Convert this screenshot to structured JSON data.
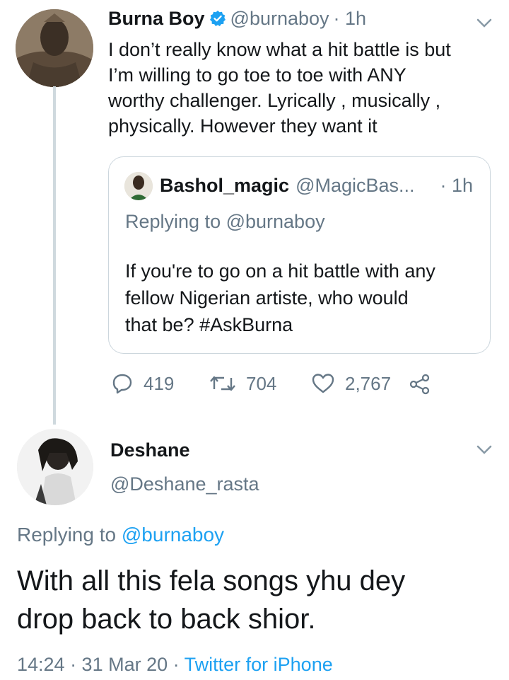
{
  "tweet": {
    "author_name": "Burna Boy",
    "handle": "@burnaboy",
    "time": "· 1h",
    "text": "I don’t really know what a hit battle is but\nI’m willing to go toe to toe with ANY\nworthy challenger. Lyrically , musically ,\nphysically. However they want it",
    "quote": {
      "author_name": "Bashol_magic",
      "handle": "@MagicBas...",
      "time": "· 1h",
      "replying_prefix": "Replying to ",
      "replying_handle": "@burnaboy",
      "text": "If you're to go on a hit battle with any\nfellow Nigerian artiste, who would\nthat be? #AskBurna"
    },
    "actions": {
      "replies": "419",
      "retweets": "704",
      "likes": "2,767"
    }
  },
  "reply": {
    "author_name": "Deshane",
    "handle": "@Deshane_rasta",
    "replying_prefix": "Replying to ",
    "replying_handle": "@burnaboy",
    "text": "With all this fela songs yhu dey\ndrop back to back shior.",
    "time": "14:24 · 31 Mar 20 · ",
    "source": "Twitter for iPhone"
  },
  "colors": {
    "accent": "#1da1f2",
    "muted": "#657786",
    "border": "#ccd6dd"
  },
  "icons": [
    "verified-badge-icon",
    "chevron-down-icon",
    "reply-icon",
    "retweet-icon",
    "like-icon",
    "share-icon"
  ]
}
